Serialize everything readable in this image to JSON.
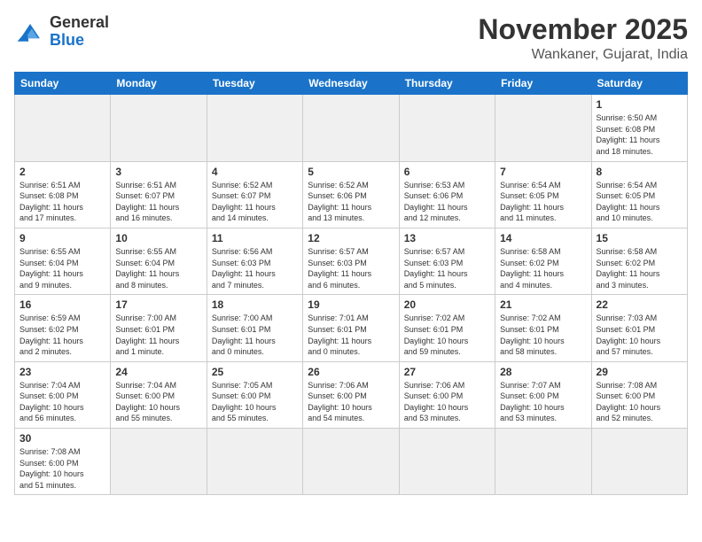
{
  "logo": {
    "text_general": "General",
    "text_blue": "Blue"
  },
  "header": {
    "month": "November 2025",
    "location": "Wankaner, Gujarat, India"
  },
  "weekdays": [
    "Sunday",
    "Monday",
    "Tuesday",
    "Wednesday",
    "Thursday",
    "Friday",
    "Saturday"
  ],
  "weeks": [
    [
      {
        "day": "",
        "info": ""
      },
      {
        "day": "",
        "info": ""
      },
      {
        "day": "",
        "info": ""
      },
      {
        "day": "",
        "info": ""
      },
      {
        "day": "",
        "info": ""
      },
      {
        "day": "",
        "info": ""
      },
      {
        "day": "1",
        "info": "Sunrise: 6:50 AM\nSunset: 6:08 PM\nDaylight: 11 hours\nand 18 minutes."
      }
    ],
    [
      {
        "day": "2",
        "info": "Sunrise: 6:51 AM\nSunset: 6:08 PM\nDaylight: 11 hours\nand 17 minutes."
      },
      {
        "day": "3",
        "info": "Sunrise: 6:51 AM\nSunset: 6:07 PM\nDaylight: 11 hours\nand 16 minutes."
      },
      {
        "day": "4",
        "info": "Sunrise: 6:52 AM\nSunset: 6:07 PM\nDaylight: 11 hours\nand 14 minutes."
      },
      {
        "day": "5",
        "info": "Sunrise: 6:52 AM\nSunset: 6:06 PM\nDaylight: 11 hours\nand 13 minutes."
      },
      {
        "day": "6",
        "info": "Sunrise: 6:53 AM\nSunset: 6:06 PM\nDaylight: 11 hours\nand 12 minutes."
      },
      {
        "day": "7",
        "info": "Sunrise: 6:54 AM\nSunset: 6:05 PM\nDaylight: 11 hours\nand 11 minutes."
      },
      {
        "day": "8",
        "info": "Sunrise: 6:54 AM\nSunset: 6:05 PM\nDaylight: 11 hours\nand 10 minutes."
      }
    ],
    [
      {
        "day": "9",
        "info": "Sunrise: 6:55 AM\nSunset: 6:04 PM\nDaylight: 11 hours\nand 9 minutes."
      },
      {
        "day": "10",
        "info": "Sunrise: 6:55 AM\nSunset: 6:04 PM\nDaylight: 11 hours\nand 8 minutes."
      },
      {
        "day": "11",
        "info": "Sunrise: 6:56 AM\nSunset: 6:03 PM\nDaylight: 11 hours\nand 7 minutes."
      },
      {
        "day": "12",
        "info": "Sunrise: 6:57 AM\nSunset: 6:03 PM\nDaylight: 11 hours\nand 6 minutes."
      },
      {
        "day": "13",
        "info": "Sunrise: 6:57 AM\nSunset: 6:03 PM\nDaylight: 11 hours\nand 5 minutes."
      },
      {
        "day": "14",
        "info": "Sunrise: 6:58 AM\nSunset: 6:02 PM\nDaylight: 11 hours\nand 4 minutes."
      },
      {
        "day": "15",
        "info": "Sunrise: 6:58 AM\nSunset: 6:02 PM\nDaylight: 11 hours\nand 3 minutes."
      }
    ],
    [
      {
        "day": "16",
        "info": "Sunrise: 6:59 AM\nSunset: 6:02 PM\nDaylight: 11 hours\nand 2 minutes."
      },
      {
        "day": "17",
        "info": "Sunrise: 7:00 AM\nSunset: 6:01 PM\nDaylight: 11 hours\nand 1 minute."
      },
      {
        "day": "18",
        "info": "Sunrise: 7:00 AM\nSunset: 6:01 PM\nDaylight: 11 hours\nand 0 minutes."
      },
      {
        "day": "19",
        "info": "Sunrise: 7:01 AM\nSunset: 6:01 PM\nDaylight: 11 hours\nand 0 minutes."
      },
      {
        "day": "20",
        "info": "Sunrise: 7:02 AM\nSunset: 6:01 PM\nDaylight: 10 hours\nand 59 minutes."
      },
      {
        "day": "21",
        "info": "Sunrise: 7:02 AM\nSunset: 6:01 PM\nDaylight: 10 hours\nand 58 minutes."
      },
      {
        "day": "22",
        "info": "Sunrise: 7:03 AM\nSunset: 6:01 PM\nDaylight: 10 hours\nand 57 minutes."
      }
    ],
    [
      {
        "day": "23",
        "info": "Sunrise: 7:04 AM\nSunset: 6:00 PM\nDaylight: 10 hours\nand 56 minutes."
      },
      {
        "day": "24",
        "info": "Sunrise: 7:04 AM\nSunset: 6:00 PM\nDaylight: 10 hours\nand 55 minutes."
      },
      {
        "day": "25",
        "info": "Sunrise: 7:05 AM\nSunset: 6:00 PM\nDaylight: 10 hours\nand 55 minutes."
      },
      {
        "day": "26",
        "info": "Sunrise: 7:06 AM\nSunset: 6:00 PM\nDaylight: 10 hours\nand 54 minutes."
      },
      {
        "day": "27",
        "info": "Sunrise: 7:06 AM\nSunset: 6:00 PM\nDaylight: 10 hours\nand 53 minutes."
      },
      {
        "day": "28",
        "info": "Sunrise: 7:07 AM\nSunset: 6:00 PM\nDaylight: 10 hours\nand 53 minutes."
      },
      {
        "day": "29",
        "info": "Sunrise: 7:08 AM\nSunset: 6:00 PM\nDaylight: 10 hours\nand 52 minutes."
      }
    ],
    [
      {
        "day": "30",
        "info": "Sunrise: 7:08 AM\nSunset: 6:00 PM\nDaylight: 10 hours\nand 51 minutes."
      },
      {
        "day": "",
        "info": ""
      },
      {
        "day": "",
        "info": ""
      },
      {
        "day": "",
        "info": ""
      },
      {
        "day": "",
        "info": ""
      },
      {
        "day": "",
        "info": ""
      },
      {
        "day": "",
        "info": ""
      }
    ]
  ]
}
